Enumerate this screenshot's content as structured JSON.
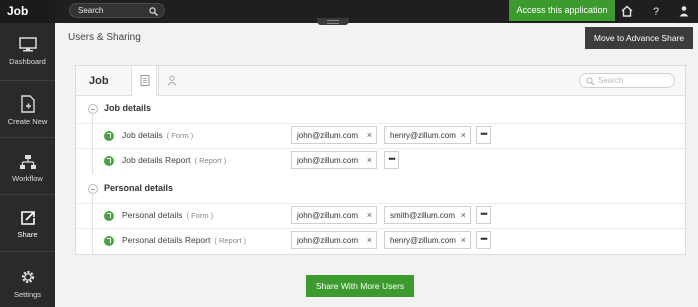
{
  "app": {
    "title": "Job"
  },
  "sidebar": {
    "items": [
      {
        "label": "Dashboard",
        "icon": "monitor-icon"
      },
      {
        "label": "Create New",
        "icon": "new-page-icon"
      },
      {
        "label": "Workflow",
        "icon": "workflow-icon"
      },
      {
        "label": "Share",
        "icon": "share-icon",
        "active": true
      },
      {
        "label": "Settings",
        "icon": "gear-icon"
      }
    ]
  },
  "topbar": {
    "search_label": "Search",
    "access_label": "Access this application",
    "accent": "#3d9a2f"
  },
  "header": {
    "title": "Users & Sharing",
    "advance_label": "Move to Advance Share"
  },
  "panel": {
    "title": "Job",
    "search_placeholder": "Search",
    "sections": [
      {
        "title": "Job details",
        "rows": [
          {
            "name": "Job details",
            "type": "( Form )",
            "users": [
              "john@zillum.com",
              "henry@zillum.com"
            ]
          },
          {
            "name": "Job details Report",
            "type": "( Report )",
            "users": [
              "john@zillum.com"
            ]
          }
        ]
      },
      {
        "title": "Personal details",
        "rows": [
          {
            "name": "Personal details",
            "type": "( Form )",
            "users": [
              "john@zillum.com",
              "smith@zillum.com"
            ]
          },
          {
            "name": "Personal details Report",
            "type": "( Report )",
            "users": [
              "john@zillum.com",
              "henry@zillum.com"
            ]
          }
        ]
      }
    ],
    "remove_glyph": "×",
    "more_glyph": "•••"
  },
  "footer": {
    "share_more_label": "Share With More Users"
  }
}
